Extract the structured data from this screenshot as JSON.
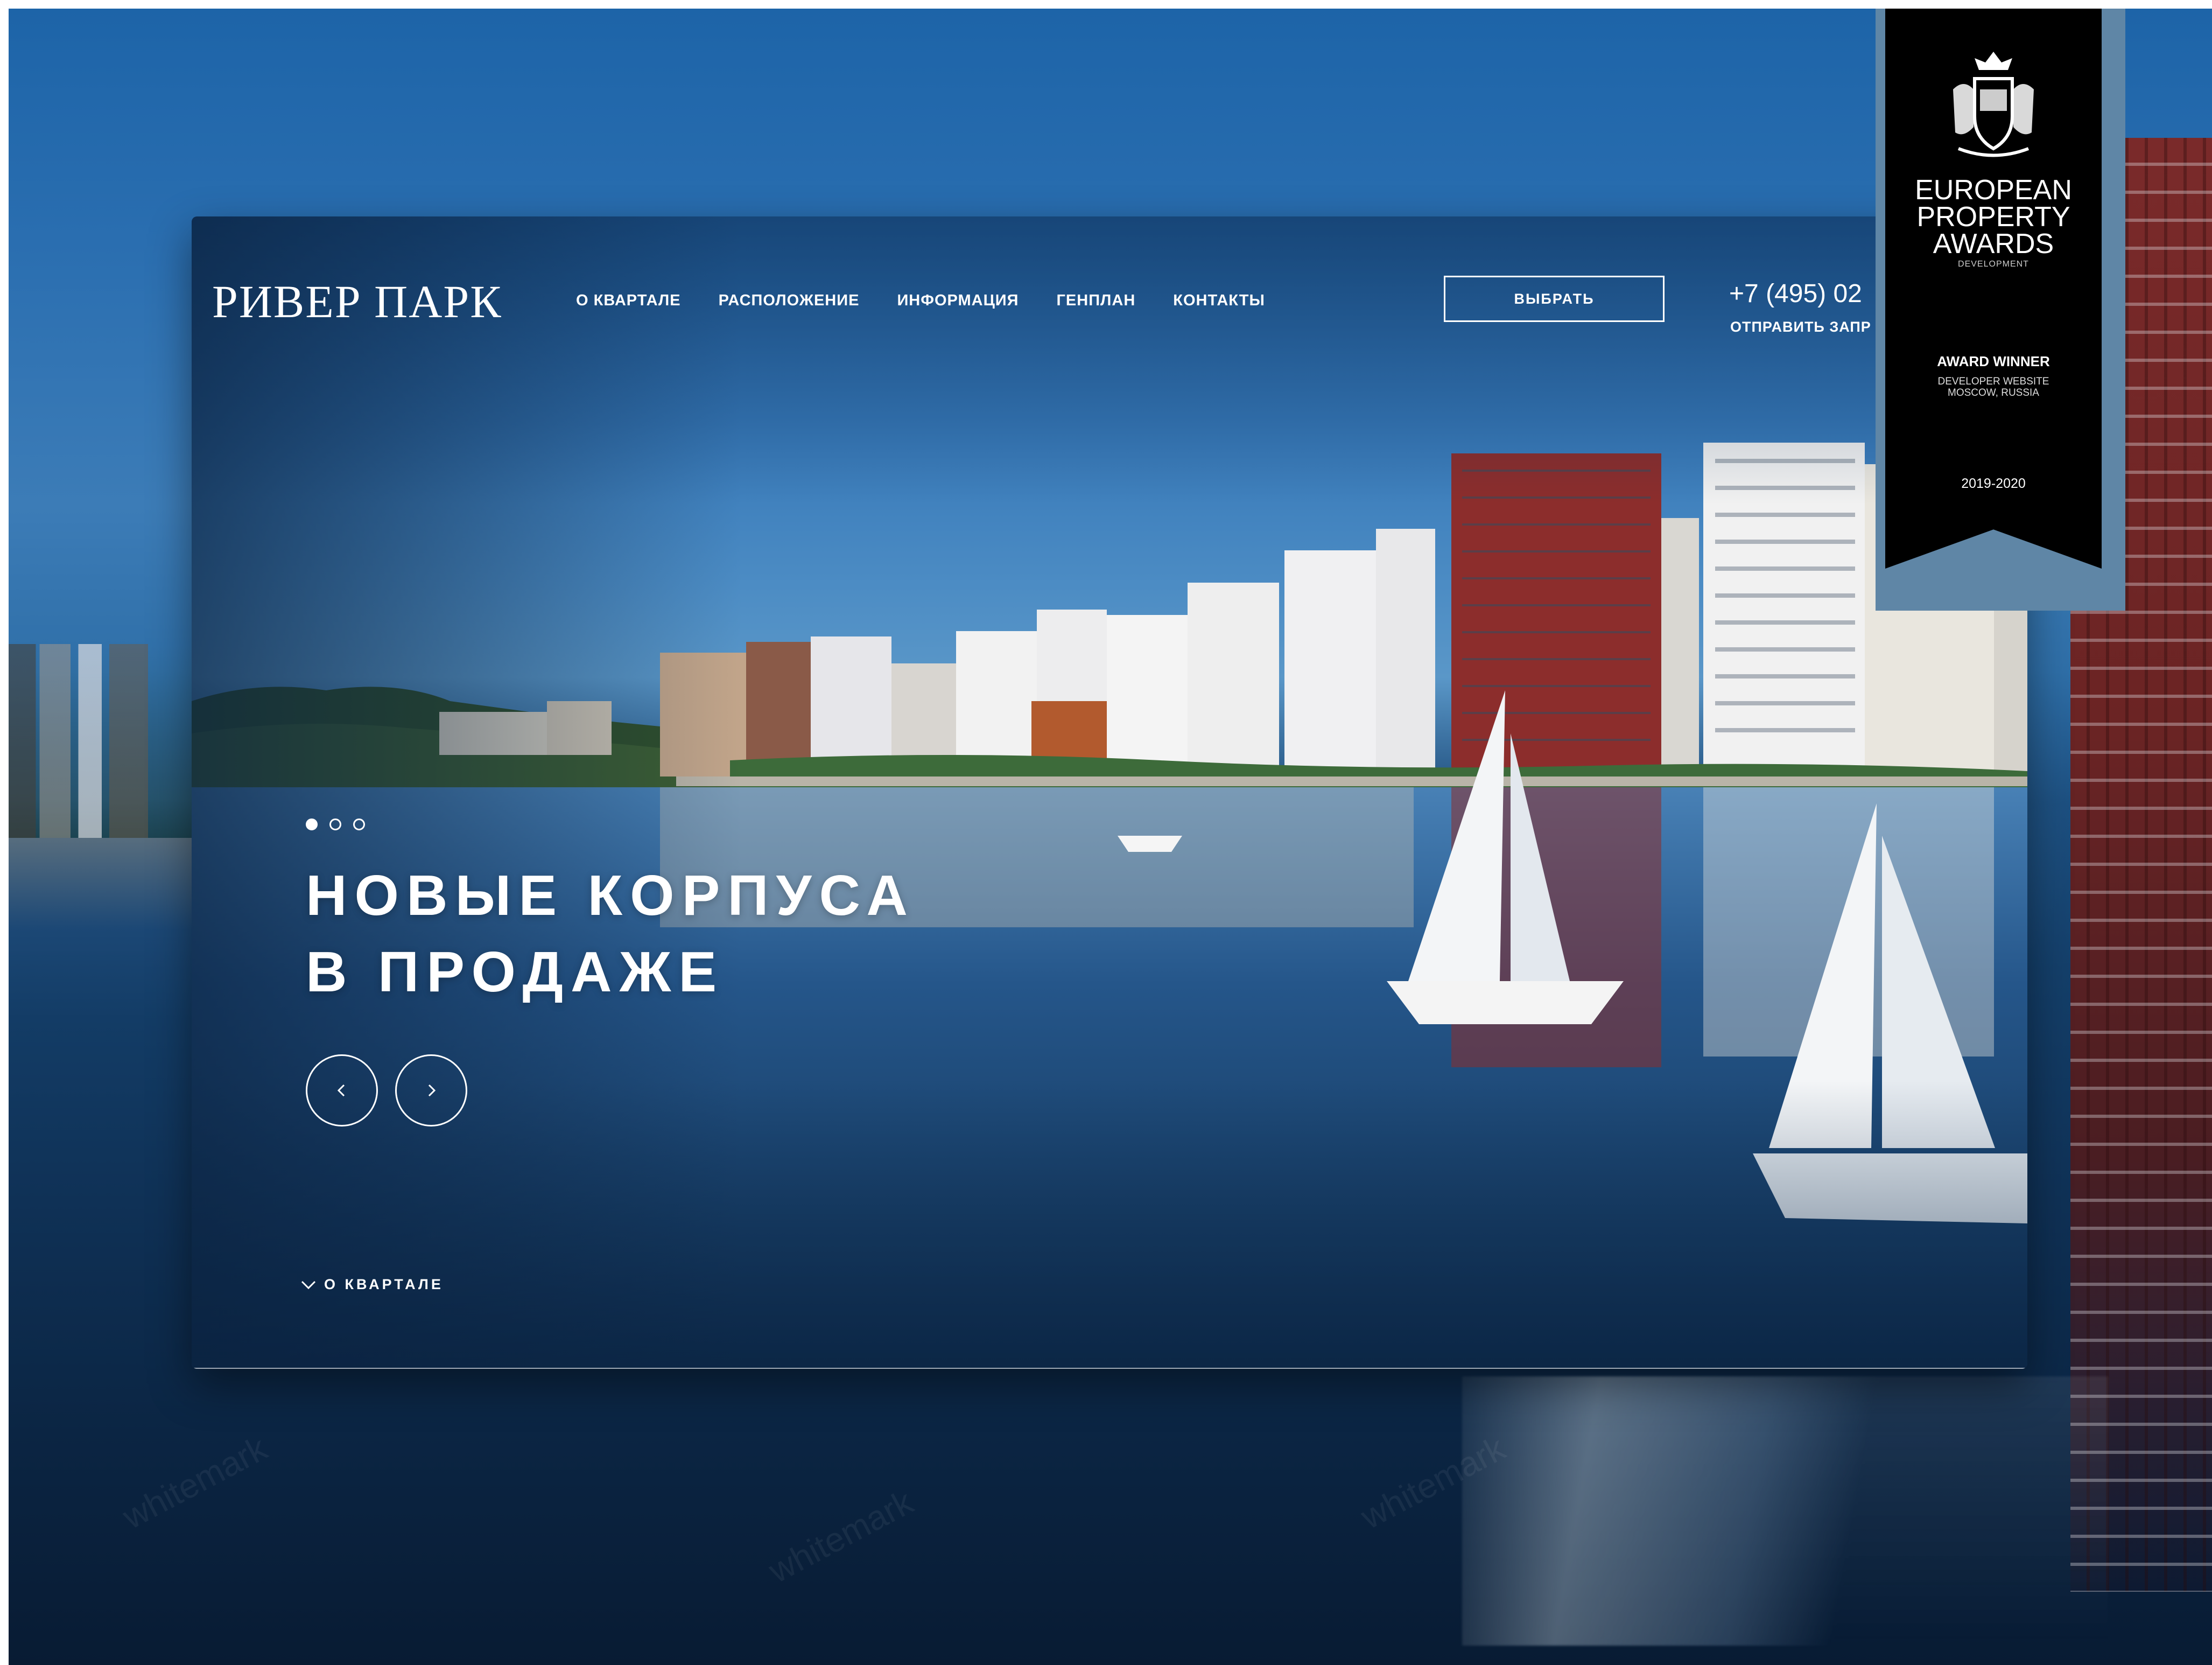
{
  "site": {
    "logo": "РИВЕР ПАРК",
    "nav": [
      {
        "label": "О КВАРТАЛЕ"
      },
      {
        "label": "РАСПОЛОЖЕНИЕ"
      },
      {
        "label": "ИНФОРМАЦИЯ"
      },
      {
        "label": "ГЕНПЛАН"
      },
      {
        "label": "КОНТАКТЫ"
      }
    ],
    "select_button": "ВЫБРАТЬ",
    "phone": "+7 (495) 02",
    "request_link": "ОТПРАВИТЬ ЗАПР"
  },
  "hero": {
    "headline_line1": "НОВЫЕ КОРПУСА",
    "headline_line2": "В ПРОДАЖЕ",
    "slides_total": 3,
    "active_slide": 1,
    "scroll_link": "О КВАРТАЛЕ"
  },
  "side_toolbar": {
    "icons": [
      "location-pin-circle-icon",
      "video-play-icon",
      "hot-air-balloon-icon",
      "bar-chart-icon",
      "map-pin-icon"
    ]
  },
  "award": {
    "title_line1": "EUROPEAN",
    "title_line2": "PROPERTY",
    "title_line3": "AWARDS",
    "subtitle": "DEVELOPMENT",
    "winner": "AWARD WINNER",
    "category_line1": "DEVELOPER WEBSITE",
    "category_line2": "MOSCOW, RUSSIA",
    "years": "2019-2020"
  },
  "watermark": "whitemark",
  "colors": {
    "sky": "#2468ad",
    "water_dark": "#0f2f50",
    "award_frame": "#5f86a6",
    "award_ribbon": "#000000",
    "text": "#ffffff"
  }
}
